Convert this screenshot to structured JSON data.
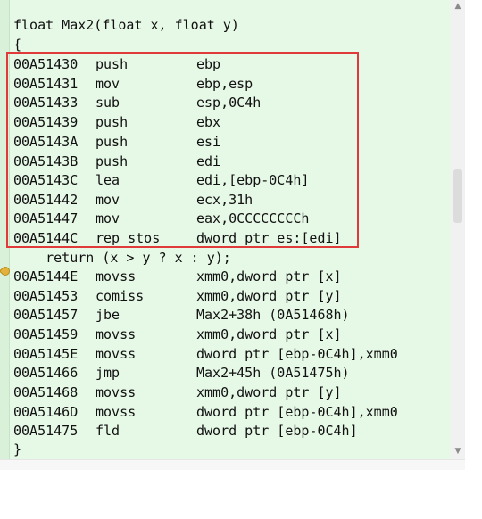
{
  "source": {
    "signature": "float Max2(float x, float y)",
    "open_brace": "{",
    "return_stmt": "    return (x > y ? x : y);",
    "close_brace": "}"
  },
  "disasm": [
    {
      "addr": "00A51430",
      "mnemonic": "push",
      "operands": "ebp"
    },
    {
      "addr": "00A51431",
      "mnemonic": "mov",
      "operands": "ebp,esp"
    },
    {
      "addr": "00A51433",
      "mnemonic": "sub",
      "operands": "esp,0C4h"
    },
    {
      "addr": "00A51439",
      "mnemonic": "push",
      "operands": "ebx"
    },
    {
      "addr": "00A5143A",
      "mnemonic": "push",
      "operands": "esi"
    },
    {
      "addr": "00A5143B",
      "mnemonic": "push",
      "operands": "edi"
    },
    {
      "addr": "00A5143C",
      "mnemonic": "lea",
      "operands": "edi,[ebp-0C4h]"
    },
    {
      "addr": "00A51442",
      "mnemonic": "mov",
      "operands": "ecx,31h"
    },
    {
      "addr": "00A51447",
      "mnemonic": "mov",
      "operands": "eax,0CCCCCCCCh"
    },
    {
      "addr": "00A5144C",
      "mnemonic": "rep stos",
      "operands": "dword ptr es:[edi]"
    },
    {
      "addr": "00A5144E",
      "mnemonic": "movss",
      "operands": "xmm0,dword ptr [x]"
    },
    {
      "addr": "00A51453",
      "mnemonic": "comiss",
      "operands": "xmm0,dword ptr [y]"
    },
    {
      "addr": "00A51457",
      "mnemonic": "jbe",
      "operands": "Max2+38h (0A51468h)"
    },
    {
      "addr": "00A51459",
      "mnemonic": "movss",
      "operands": "xmm0,dword ptr [x]"
    },
    {
      "addr": "00A5145E",
      "mnemonic": "movss",
      "operands": "dword ptr [ebp-0C4h],xmm0"
    },
    {
      "addr": "00A51466",
      "mnemonic": "jmp",
      "operands": "Max2+45h (0A51475h)"
    },
    {
      "addr": "00A51468",
      "mnemonic": "movss",
      "operands": "xmm0,dword ptr [y]"
    },
    {
      "addr": "00A5146D",
      "mnemonic": "movss",
      "operands": "dword ptr [ebp-0C4h],xmm0"
    },
    {
      "addr": "00A51475",
      "mnemonic": "fld",
      "operands": "dword ptr [ebp-0C4h]"
    }
  ],
  "colors": {
    "background": "#e6f8e6",
    "highlight_border": "#e03a3a",
    "instruction_pointer": "#e3b23c"
  },
  "icons": {
    "instruction_pointer": "current-instruction-arrow-icon",
    "scroll_up": "scroll-up-icon",
    "scroll_down": "scroll-down-icon"
  },
  "scroll": {
    "up_glyph": "▲",
    "down_glyph": "▼"
  }
}
